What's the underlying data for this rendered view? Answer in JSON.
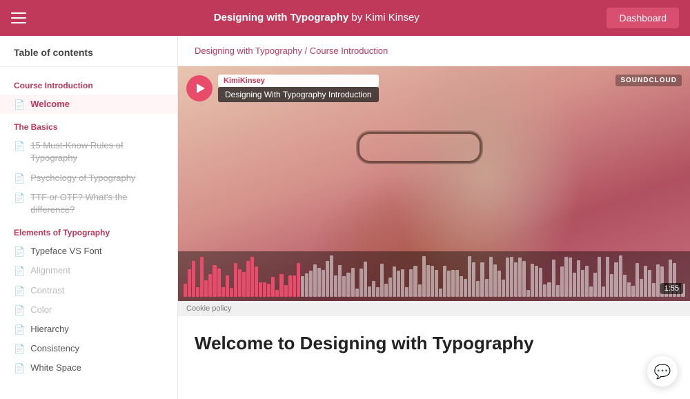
{
  "nav": {
    "title": "Designing with Typography",
    "author": "by Kimi Kinsey",
    "dashboard_label": "Dashboard"
  },
  "breadcrumb": {
    "part1": "Designing with Typography",
    "separator": " / ",
    "part2": "Course Introduction"
  },
  "sidebar": {
    "title": "Table of contents",
    "sections": [
      {
        "label": "Course Introduction",
        "items": [
          {
            "id": "welcome",
            "label": "Welcome",
            "active": true,
            "strikethrough": false
          }
        ]
      },
      {
        "label": "The Basics",
        "items": [
          {
            "id": "15rules",
            "label": "15 Must-Know Rules of Typography",
            "active": false,
            "strikethrough": true
          },
          {
            "id": "psychology",
            "label": "Psychology of Typography",
            "active": false,
            "strikethrough": true
          },
          {
            "id": "ttf",
            "label": "TTF or OTF? What's the difference?",
            "active": false,
            "strikethrough": true
          }
        ]
      },
      {
        "label": "Elements of Typography",
        "items": [
          {
            "id": "typeface",
            "label": "Typeface VS Font",
            "active": false,
            "strikethrough": false
          },
          {
            "id": "alignment",
            "label": "Alignment",
            "active": false,
            "strikethrough": false
          },
          {
            "id": "contrast",
            "label": "Contrast",
            "active": false,
            "strikethrough": false
          },
          {
            "id": "color",
            "label": "Color",
            "active": false,
            "strikethrough": false
          },
          {
            "id": "hierarchy",
            "label": "Hierarchy",
            "active": false,
            "strikethrough": false
          },
          {
            "id": "consistency",
            "label": "Consistency",
            "active": false,
            "strikethrough": false
          },
          {
            "id": "whitespace",
            "label": "White Space",
            "active": false,
            "strikethrough": false
          }
        ]
      }
    ]
  },
  "video": {
    "user_tag": "KimiKinsey",
    "track_title": "Designing With Typography Introduction",
    "soundcloud_label": "SOUNDCLOUD",
    "time": "1:55",
    "cookie_policy": "Cookie policy"
  },
  "welcome": {
    "heading": "Welcome to Designing with Typography"
  },
  "chat": {
    "icon": "💬"
  }
}
